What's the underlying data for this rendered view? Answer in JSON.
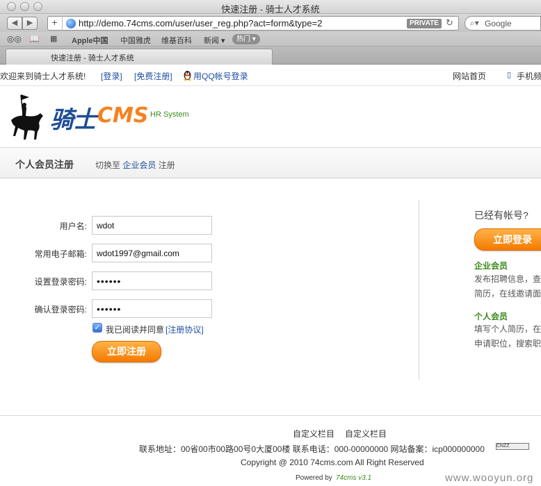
{
  "browser": {
    "window_title": "快速注册 - 骑士人才系统",
    "url": "http://demo.74cms.com/user/user_reg.php?act=form&type=2",
    "private_label": "PRIVATE",
    "search_placeholder": "Google",
    "bookmarks": [
      "Apple中国",
      "中国雅虎",
      "维基百科",
      "新闻 ▾"
    ],
    "hot_label": "热门 ▾",
    "tab_title": "快速注册 - 骑士人才系统"
  },
  "topnav": {
    "welcome": "欢迎来到骑士人才系统!",
    "login_link": "[登录]",
    "register_link": "[免费注册]",
    "qq_login": "用QQ帐号登录",
    "home_link": "网站首页",
    "mobile_link": "手机频"
  },
  "header": {
    "logo_text": "骑士",
    "logo_cms": "CMS",
    "hr_system": "HR System"
  },
  "subbar": {
    "title": "个人会员注册",
    "switch_prefix": "切换至",
    "switch_link": "企业会员",
    "switch_suffix": "注册"
  },
  "form": {
    "username_label": "用户名:",
    "username_value": "wdot",
    "email_label": "常用电子邮箱:",
    "email_value": "wdot1997@gmail.com",
    "password_label": "设置登录密码:",
    "password_value": "••••••",
    "confirm_label": "确认登录密码:",
    "confirm_value": "••••••",
    "agree_text": "我已阅读并同意",
    "agreement_link": "[注册协议]",
    "submit_label": "立即注册"
  },
  "sidebar": {
    "have_account": "已经有帐号?",
    "login_button": "立即登录",
    "company_title": "企业会员",
    "company_line1": "发布招聘信息，查",
    "company_line2": "简历，在线邀请面",
    "person_title": "个人会员",
    "person_line1": "填写个人简历，在",
    "person_line2": "申请职位，搜索职"
  },
  "footer": {
    "custom1": "自定义栏目",
    "custom2": "自定义栏目",
    "contact": "联系地址：00省00市00路00号0大厦00楼 联系电话：000-00000000 网站备案：icp000000000",
    "badge": "CNZZ",
    "copyright": "Copyright @ 2010 74cms.com All Right Reserved",
    "powered_prefix": "Powered by",
    "powered_name": "74cms v3.1"
  },
  "watermark": "www.wooyun.org",
  "colors": {
    "link": "#1f4fa0",
    "orange": "#f47a00",
    "green": "#3a8a1b",
    "logo_blue": "#1e4d95"
  }
}
